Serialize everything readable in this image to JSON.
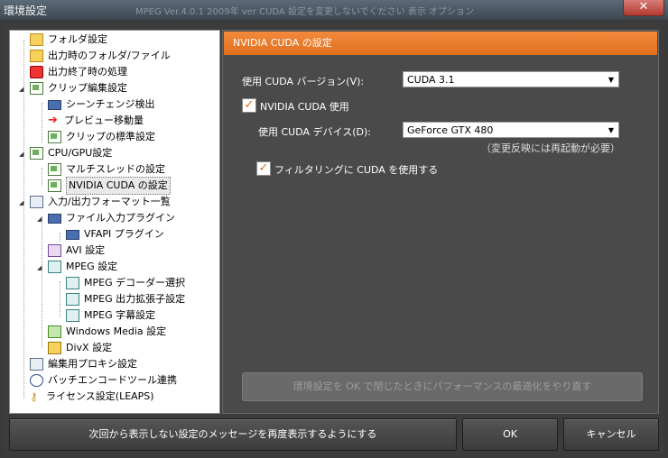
{
  "window": {
    "title": "環境設定",
    "background_text": "MPEG Ver.4.0.1 2009年 ver CUDA 設定を変更しないでください 表示 オプション"
  },
  "tree": {
    "items": [
      {
        "label": "フォルダ設定",
        "icon": "folder-icon"
      },
      {
        "label": "出力時のフォルダ/ファイル",
        "icon": "folder-output-icon"
      },
      {
        "label": "出力終了時の処理",
        "icon": "power-icon"
      },
      {
        "label": "クリップ編集設定",
        "icon": "clip-edit-icon"
      },
      {
        "label": "シーンチェンジ検出",
        "icon": "scene-change-icon"
      },
      {
        "label": "プレビュー移動量",
        "icon": "arrow-icon"
      },
      {
        "label": "クリップの標準設定",
        "icon": "document-icon"
      },
      {
        "label": "CPU/GPU設定",
        "icon": "document-icon"
      },
      {
        "label": "マルチスレッドの設定",
        "icon": "document-icon"
      },
      {
        "label": "NVIDIA CUDA の設定",
        "icon": "document-icon"
      },
      {
        "label": "入力/出力フォーマット一覧",
        "icon": "list-icon"
      },
      {
        "label": "ファイル入力プラグイン",
        "icon": "monitor-icon"
      },
      {
        "label": "VFAPI プラグイン",
        "icon": "monitor-icon"
      },
      {
        "label": "AVI 設定",
        "icon": "avi-icon"
      },
      {
        "label": "MPEG 設定",
        "icon": "mpeg-icon"
      },
      {
        "label": "MPEG デコーダー選択",
        "icon": "mpeg-icon"
      },
      {
        "label": "MPEG 出力拡張子設定",
        "icon": "mpeg-icon"
      },
      {
        "label": "MPEG 字幕設定",
        "icon": "mpeg-icon"
      },
      {
        "label": "Windows Media 設定",
        "icon": "windows-media-icon"
      },
      {
        "label": "DivX 設定",
        "icon": "divx-icon"
      },
      {
        "label": "編集用プロキシ設定",
        "icon": "proxy-icon"
      },
      {
        "label": "バッチエンコードツール連携",
        "icon": "clock-icon"
      },
      {
        "label": "ライセンス設定(LEAPS)",
        "icon": "key-icon"
      }
    ],
    "selected": "NVIDIA CUDA の設定"
  },
  "panel": {
    "header": "NVIDIA CUDA の設定",
    "cuda_version_label": "使用 CUDA バージョン(V):",
    "cuda_version_value": "CUDA 3.1",
    "use_cuda_label": "NVIDIA CUDA 使用",
    "use_cuda_checked": true,
    "device_label": "使用 CUDA デバイス(D):",
    "device_value": "GeForce GTX 480",
    "restart_note": "（変更反映には再起動が必要）",
    "filtering_label": "フィルタリングに CUDA を使用する",
    "filtering_checked": true,
    "optimize_button": "環境設定を OK で閉じたときにパフォーマンスの最適化をやり直す"
  },
  "footer": {
    "reset_messages_button": "次回から表示しない設定のメッセージを再度表示するようにする",
    "ok_button": "OK",
    "cancel_button": "キャンセル"
  },
  "colors": {
    "accent": "#f0822f",
    "panel_bg": "#4a4a4a",
    "window_bg": "#3a3a3a",
    "check_mark": "#e06a14"
  }
}
